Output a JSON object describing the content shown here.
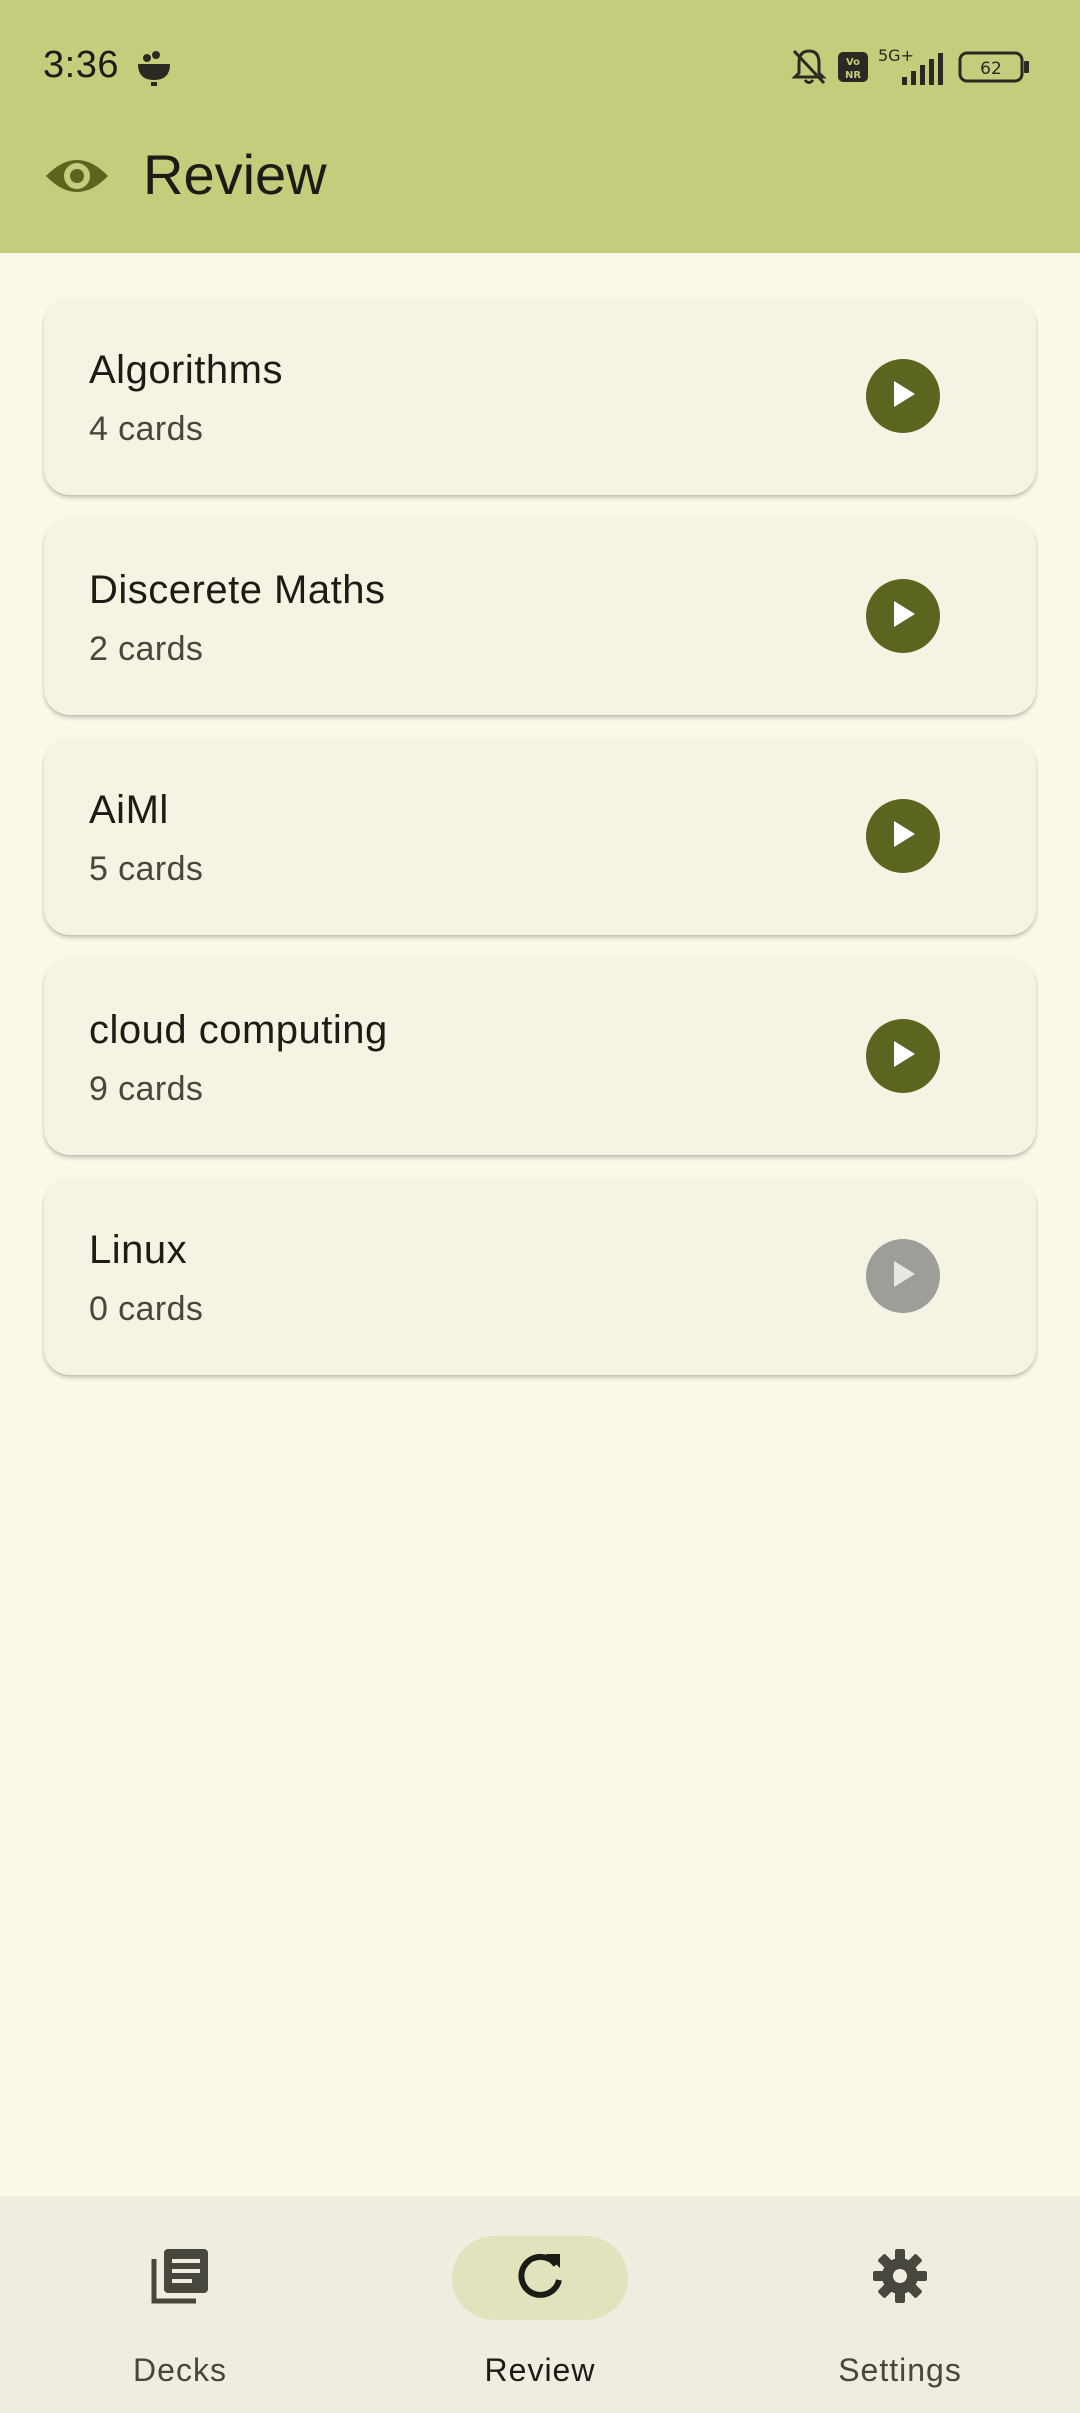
{
  "status_bar": {
    "time": "3:36",
    "network": "5G+",
    "volte": "Vo NR",
    "battery": "62"
  },
  "app_bar": {
    "title": "Review",
    "icon": "eye-icon"
  },
  "decks": [
    {
      "name": "Algorithms",
      "count": "4 cards",
      "enabled": true
    },
    {
      "name": "Discerete Maths",
      "count": "2 cards",
      "enabled": true
    },
    {
      "name": "AiMl",
      "count": "5 cards",
      "enabled": true
    },
    {
      "name": "cloud computing",
      "count": "9 cards",
      "enabled": true
    },
    {
      "name": "Linux",
      "count": "0 cards",
      "enabled": false
    }
  ],
  "bottom_nav": {
    "items": [
      {
        "label": "Decks",
        "icon": "decks-icon",
        "active": false
      },
      {
        "label": "Review",
        "icon": "refresh-icon",
        "active": true
      },
      {
        "label": "Settings",
        "icon": "gear-icon",
        "active": false
      }
    ]
  },
  "colors": {
    "app_bar": "#c5cc7c",
    "background": "#fbf8ea",
    "card": "#f6f3e4",
    "accent": "#5c6520",
    "disabled": "#9e9e98",
    "nav_active_pill": "#e2e3bd"
  }
}
